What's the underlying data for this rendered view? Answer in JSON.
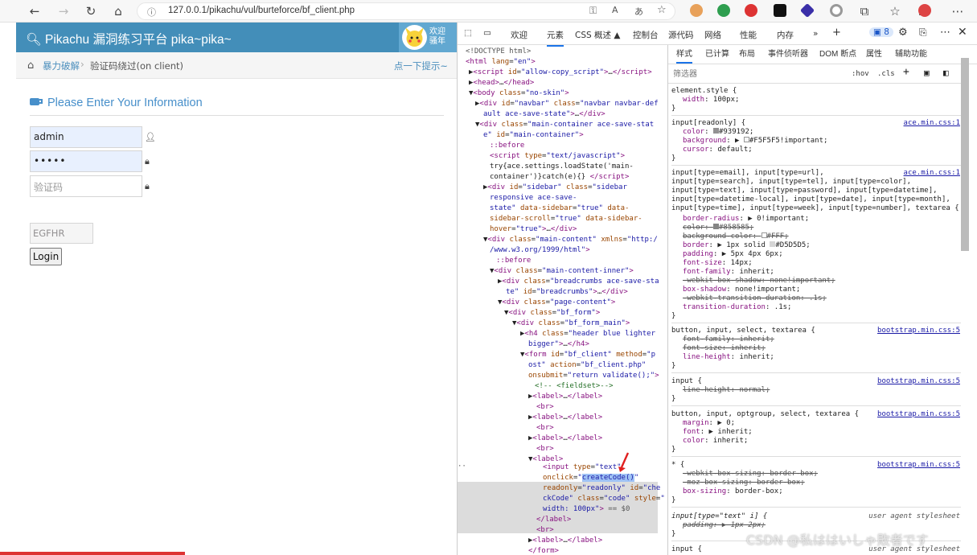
{
  "browser": {
    "url": "127.0.0.1/pikachu/vul/burteforce/bf_client.php"
  },
  "page": {
    "brand": "Pikachu 漏洞练习平台 pika~pika~",
    "welcome": "欢迎骚年",
    "breadcrumb": [
      "暴力破解",
      "验证码绕过(on client)"
    ],
    "hint": "点一下提示~",
    "header": "Please Enter Your Information",
    "username_value": "admin",
    "password_value": "•••••",
    "captcha_placeholder": "验证码",
    "code_value": "EGFHR",
    "login_label": "Login"
  },
  "devtools": {
    "tabs": [
      "欢迎",
      "元素",
      "CSS 概述 ▲",
      "控制台",
      "源代码",
      "网络",
      "性能",
      "内存",
      "»",
      "+"
    ],
    "issues_badge": "8",
    "styles_tabs": [
      "样式",
      "已计算",
      "布局",
      "事件侦听器",
      "DOM 断点",
      "属性",
      "辅助功能"
    ],
    "filter_placeholder": "筛选器",
    "filter_hov": ":hov",
    "filter_cls": ".cls"
  },
  "watermark": "CSDN @私ははいしゃ敗者です",
  "colors": {
    "navbar": "#438eb9",
    "header_blue": "#478fca",
    "link_blue": "#4c8fbd"
  }
}
